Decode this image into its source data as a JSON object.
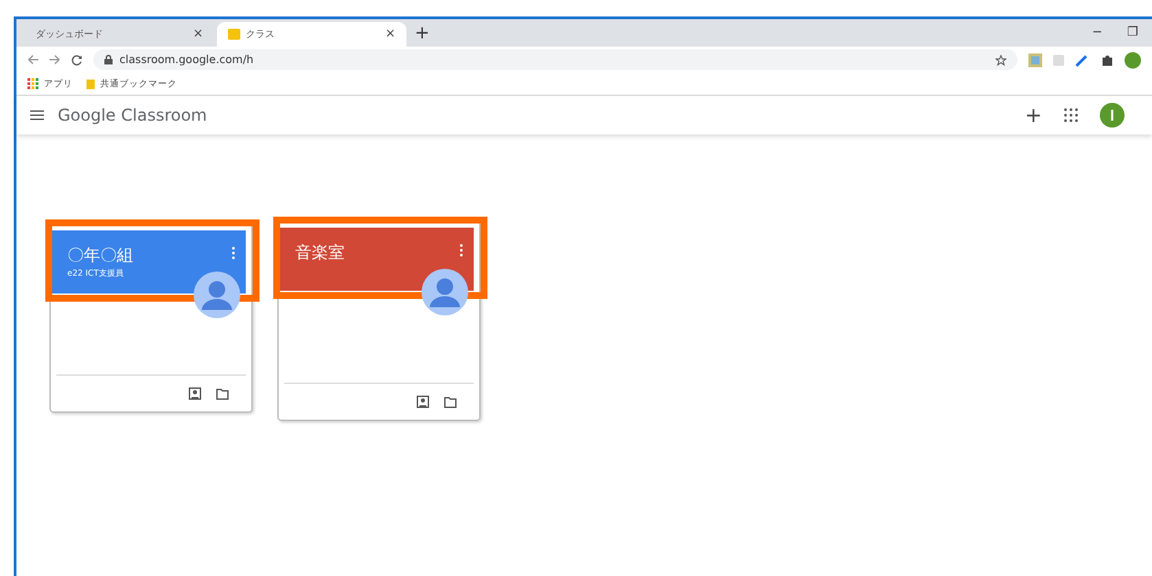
{
  "browser": {
    "tabs": [
      {
        "label": "ダッシュボード",
        "selected": false,
        "close": "×"
      },
      {
        "label": "クラス",
        "selected": true,
        "close": "×"
      }
    ],
    "new_tab": "+",
    "window_controls": [
      "−",
      "❐"
    ],
    "address": "classroom.google.com/h",
    "bookmarks": [
      {
        "kind": "apps",
        "label": "アプリ"
      },
      {
        "kind": "folder",
        "label": "共通ブックマーク"
      }
    ]
  },
  "app": {
    "title": "Google Classroom",
    "add": "+"
  },
  "classes": [
    {
      "name": "〇年〇組",
      "section": "e22 ICT支援員",
      "color": "#3a83ea",
      "highlighted": true
    },
    {
      "name": "音楽室",
      "color": "#d14836",
      "highlighted": true
    }
  ]
}
